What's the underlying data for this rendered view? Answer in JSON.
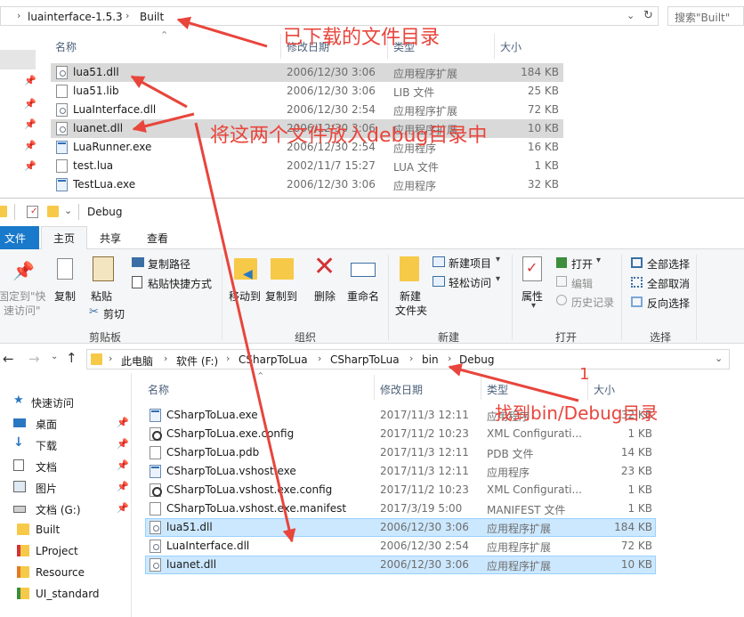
{
  "top_window": {
    "breadcrumbs": [
      "luainterface-1.5.3",
      "Built"
    ],
    "search_placeholder": "搜索\"Built\"",
    "columns": [
      "名称",
      "修改日期",
      "类型",
      "大小"
    ],
    "files": [
      {
        "name": "lua51.dll",
        "date": "2006/12/30 3:06",
        "type": "应用程序扩展",
        "size": "184 KB",
        "icon": "dll-file-icon",
        "selected": true
      },
      {
        "name": "lua51.lib",
        "date": "2006/12/30 3:06",
        "type": "LIB 文件",
        "size": "25 KB",
        "icon": "file-icon",
        "selected": false
      },
      {
        "name": "LuaInterface.dll",
        "date": "2006/12/30 2:54",
        "type": "应用程序扩展",
        "size": "72 KB",
        "icon": "dll-file-icon",
        "selected": false
      },
      {
        "name": "luanet.dll",
        "date": "2006/12/30 3:06",
        "type": "应用程序扩展",
        "size": "10 KB",
        "icon": "dll-file-icon",
        "selected": true
      },
      {
        "name": "LuaRunner.exe",
        "date": "2006/12/30 2:54",
        "type": "应用程序",
        "size": "16 KB",
        "icon": "exe-file-icon",
        "selected": false
      },
      {
        "name": "test.lua",
        "date": "2002/11/7 15:27",
        "type": "LUA 文件",
        "size": "1 KB",
        "icon": "file-icon",
        "selected": false
      },
      {
        "name": "TestLua.exe",
        "date": "2006/12/30 3:06",
        "type": "应用程序",
        "size": "32 KB",
        "icon": "exe-file-icon",
        "selected": false
      }
    ]
  },
  "bottom_window": {
    "title": "Debug",
    "tabs": {
      "file": "文件",
      "home": "主页",
      "share": "共享",
      "view": "查看"
    },
    "ribbon": {
      "pin_quick_access": [
        "固定到\"快",
        "速访问\""
      ],
      "copy": "复制",
      "paste": "粘贴",
      "copy_path": "复制路径",
      "paste_shortcut": "粘贴快捷方式",
      "cut": "剪切",
      "group_clipboard": "剪贴板",
      "move_to": "移动到",
      "copy_to": "复制到",
      "delete": "删除",
      "rename": "重命名",
      "group_organize": "组织",
      "new_folder": [
        "新建",
        "文件夹"
      ],
      "new_item": "新建项目",
      "easy_access": "轻松访问",
      "group_new": "新建",
      "properties": "属性",
      "open": "打开",
      "edit": "编辑",
      "history": "历史记录",
      "group_open": "打开",
      "select_all": "全部选择",
      "select_none": "全部取消",
      "invert_selection": "反向选择",
      "group_select": "选择"
    },
    "breadcrumbs": [
      "此电脑",
      "软件 (F:)",
      "CSharpToLua",
      "CSharpToLua",
      "bin",
      "Debug"
    ],
    "sidebar": [
      {
        "label": "快速访问",
        "icon": "star-icon",
        "pinned": false
      },
      {
        "label": "桌面",
        "icon": "desktop-icon",
        "pinned": true
      },
      {
        "label": "下载",
        "icon": "download-icon",
        "pinned": true
      },
      {
        "label": "文档",
        "icon": "documents-icon",
        "pinned": true
      },
      {
        "label": "图片",
        "icon": "pictures-icon",
        "pinned": true
      },
      {
        "label": "文档 (G:)",
        "icon": "drive-icon",
        "pinned": true
      },
      {
        "label": "Built",
        "icon": "folder-icon",
        "pinned": false
      },
      {
        "label": "LProject",
        "icon": "project-icon",
        "pinned": false
      },
      {
        "label": "Resource",
        "icon": "resource-icon",
        "pinned": false
      },
      {
        "label": "UI_standard",
        "icon": "ui-icon",
        "pinned": false
      }
    ],
    "columns": [
      "名称",
      "修改日期",
      "类型",
      "大小"
    ],
    "files": [
      {
        "name": "CSharpToLua.exe",
        "date": "2017/11/3 12:11",
        "type": "应用程序",
        "size": "32 KB",
        "icon": "exe-file-icon",
        "selected": false
      },
      {
        "name": "CSharpToLua.exe.config",
        "date": "2017/11/2 10:23",
        "type": "XML Configurati...",
        "size": "1 KB",
        "icon": "config-file-icon",
        "selected": false
      },
      {
        "name": "CSharpToLua.pdb",
        "date": "2017/11/3 12:11",
        "type": "PDB 文件",
        "size": "14 KB",
        "icon": "file-icon",
        "selected": false
      },
      {
        "name": "CSharpToLua.vshost.exe",
        "date": "2017/11/3 12:11",
        "type": "应用程序",
        "size": "23 KB",
        "icon": "exe-file-icon",
        "selected": false
      },
      {
        "name": "CSharpToLua.vshost.exe.config",
        "date": "2017/11/2 10:23",
        "type": "XML Configurati...",
        "size": "1 KB",
        "icon": "config-file-icon",
        "selected": false
      },
      {
        "name": "CSharpToLua.vshost.exe.manifest",
        "date": "2017/3/19 5:00",
        "type": "MANIFEST 文件",
        "size": "1 KB",
        "icon": "file-icon",
        "selected": false
      },
      {
        "name": "lua51.dll",
        "date": "2006/12/30 3:06",
        "type": "应用程序扩展",
        "size": "184 KB",
        "icon": "dll-file-icon",
        "selected": true
      },
      {
        "name": "LuaInterface.dll",
        "date": "2006/12/30 2:54",
        "type": "应用程序扩展",
        "size": "72 KB",
        "icon": "dll-file-icon",
        "selected": false
      },
      {
        "name": "luanet.dll",
        "date": "2006/12/30 3:06",
        "type": "应用程序扩展",
        "size": "10 KB",
        "icon": "dll-file-icon",
        "selected": true
      }
    ]
  },
  "annotations": {
    "downloaded_dir": "已下载的文件目录",
    "put_files": "将这两个文件放入debug目录中",
    "step_number": "1",
    "find_dir": "找到bin/Debug目录",
    "color": "#e8453c"
  }
}
